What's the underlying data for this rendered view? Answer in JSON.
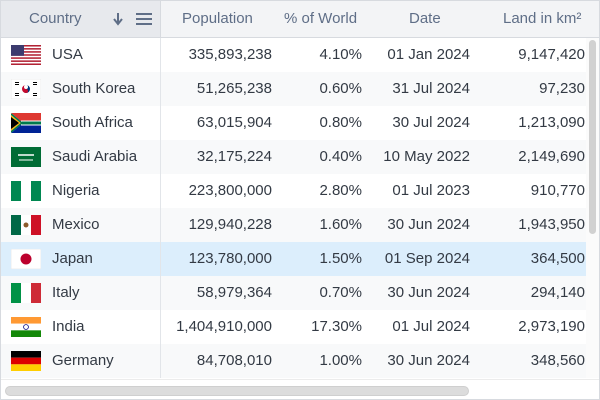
{
  "columns": {
    "country": "Country",
    "population": "Population",
    "pct_world": "% of World",
    "date": "Date",
    "land": "Land in km²"
  },
  "icons": {
    "sort": "sort-descending-icon",
    "menu": "column-menu-icon"
  },
  "colors": {
    "header_bg": "#f3f4f6",
    "pinned_header_bg": "#e7e9ed",
    "selected_row": "#dceefc",
    "text": "#333a44",
    "header_text": "#5f6e87"
  },
  "rows": [
    {
      "country": "USA",
      "population": "335,893,238",
      "pct": "4.10%",
      "date": "01 Jan 2024",
      "land": "9,147,420",
      "flag": "usa",
      "selected": false
    },
    {
      "country": "South Korea",
      "population": "51,265,238",
      "pct": "0.60%",
      "date": "31 Jul 2024",
      "land": "97,230",
      "flag": "south-korea",
      "selected": false
    },
    {
      "country": "South Africa",
      "population": "63,015,904",
      "pct": "0.80%",
      "date": "30 Jul 2024",
      "land": "1,213,090",
      "flag": "south-africa",
      "selected": false
    },
    {
      "country": "Saudi Arabia",
      "population": "32,175,224",
      "pct": "0.40%",
      "date": "10 May 2022",
      "land": "2,149,690",
      "flag": "saudi-arabia",
      "selected": false
    },
    {
      "country": "Nigeria",
      "population": "223,800,000",
      "pct": "2.80%",
      "date": "01 Jul 2023",
      "land": "910,770",
      "flag": "nigeria",
      "selected": false
    },
    {
      "country": "Mexico",
      "population": "129,940,228",
      "pct": "1.60%",
      "date": "30 Jun 2024",
      "land": "1,943,950",
      "flag": "mexico",
      "selected": false
    },
    {
      "country": "Japan",
      "population": "123,780,000",
      "pct": "1.50%",
      "date": "01 Sep 2024",
      "land": "364,500",
      "flag": "japan",
      "selected": true
    },
    {
      "country": "Italy",
      "population": "58,979,364",
      "pct": "0.70%",
      "date": "30 Jun 2024",
      "land": "294,140",
      "flag": "italy",
      "selected": false
    },
    {
      "country": "India",
      "population": "1,404,910,000",
      "pct": "17.30%",
      "date": "01 Jul 2024",
      "land": "2,973,190",
      "flag": "india",
      "selected": false
    },
    {
      "country": "Germany",
      "population": "84,708,010",
      "pct": "1.00%",
      "date": "30 Jun 2024",
      "land": "348,560",
      "flag": "germany",
      "selected": false
    }
  ]
}
